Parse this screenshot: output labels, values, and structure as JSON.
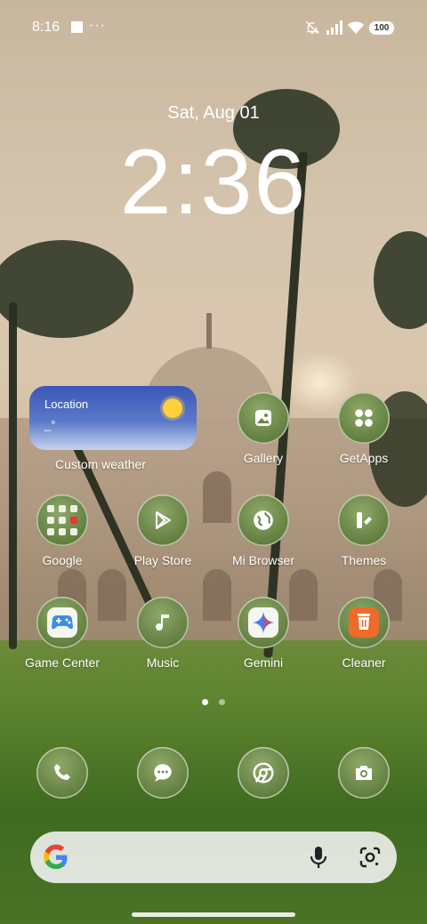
{
  "status_bar": {
    "time": "8:16",
    "more": "···",
    "battery": "100",
    "icons": [
      "notification-square-icon",
      "mute-icon",
      "signal-icon",
      "wifi-icon",
      "battery-icon"
    ]
  },
  "lockscreen": {
    "date": "Sat, Aug 01",
    "clock": "2:36"
  },
  "weather_widget": {
    "location": "Location",
    "temperature": "_°",
    "label": "Custom weather",
    "icon": "sun-icon"
  },
  "apps": [
    {
      "label": "Gallery",
      "icon": "gallery-icon"
    },
    {
      "label": "GetApps",
      "icon": "getapps-icon"
    },
    {
      "label": "Google",
      "icon": "folder-icon"
    },
    {
      "label": "Play Store",
      "icon": "play-store-icon"
    },
    {
      "label": "Mi Browser",
      "icon": "globe-icon"
    },
    {
      "label": "Themes",
      "icon": "themes-icon"
    },
    {
      "label": "Game Center",
      "icon": "gamepad-icon"
    },
    {
      "label": "Music",
      "icon": "music-note-icon"
    },
    {
      "label": "Gemini",
      "icon": "gemini-icon"
    },
    {
      "label": "Cleaner",
      "icon": "trash-icon"
    }
  ],
  "page_indicator": {
    "pages": 2,
    "active": 1
  },
  "dock": [
    {
      "name": "phone",
      "icon": "phone-icon"
    },
    {
      "name": "messages",
      "icon": "chat-bubble-icon"
    },
    {
      "name": "chrome",
      "icon": "chrome-icon"
    },
    {
      "name": "camera",
      "icon": "camera-icon"
    }
  ],
  "search_bar": {
    "icons": [
      "google-icon",
      "mic-icon",
      "lens-icon"
    ]
  },
  "colors": {
    "accent": "#5f7c3c",
    "widget_blue": "#3b57b8",
    "cleaner_orange": "#f06a2a"
  }
}
